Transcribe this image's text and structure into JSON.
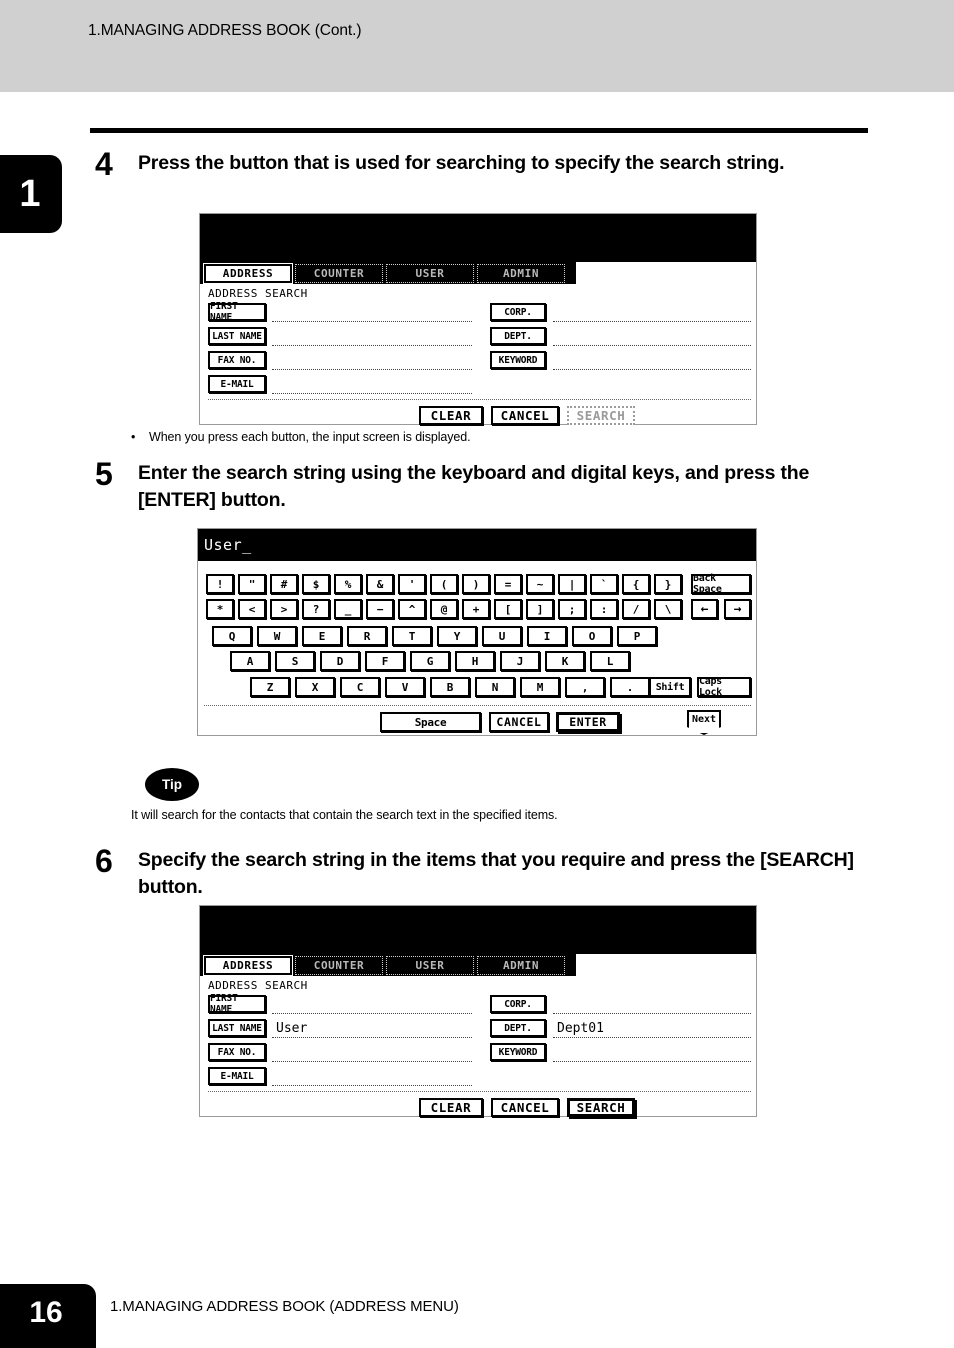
{
  "header": {
    "title": "1.MANAGING ADDRESS BOOK (Cont.)"
  },
  "side_tab": {
    "chapter": "1"
  },
  "footer": {
    "page": "16",
    "title": "1.MANAGING ADDRESS BOOK (ADDRESS MENU)"
  },
  "steps": [
    {
      "num": "4",
      "text": "Press the button that is used for searching to specify the search string."
    },
    {
      "num": "5",
      "text": "Enter the search string using the keyboard and digital keys, and press the [ENTER] button."
    },
    {
      "num": "6",
      "text": "Specify the search string in the items that you require and press the [SEARCH] button."
    }
  ],
  "note": {
    "bullet": "•",
    "text": "When you press each button, the input screen is displayed."
  },
  "tip": {
    "label": "Tip",
    "text": "It will search for the contacts that contain the search text in the specified items."
  },
  "screen_empty": {
    "tabs": [
      {
        "label": "ADDRESS",
        "selected": true
      },
      {
        "label": "COUNTER",
        "selected": false
      },
      {
        "label": "USER",
        "selected": false
      },
      {
        "label": "ADMIN",
        "selected": false
      }
    ],
    "title": "ADDRESS SEARCH",
    "left_fields": [
      {
        "label": "FIRST NAME",
        "value": ""
      },
      {
        "label": "LAST NAME",
        "value": ""
      },
      {
        "label": "FAX NO.",
        "value": ""
      },
      {
        "label": "E-MAIL",
        "value": ""
      }
    ],
    "right_fields": [
      {
        "label": "CORP.",
        "value": ""
      },
      {
        "label": "DEPT.",
        "value": ""
      },
      {
        "label": "KEYWORD",
        "value": ""
      }
    ],
    "actions": [
      {
        "label": "CLEAR",
        "state": "normal"
      },
      {
        "label": "CANCEL",
        "state": "normal"
      },
      {
        "label": "SEARCH",
        "state": "disabled"
      }
    ]
  },
  "screen_filled": {
    "tabs": [
      {
        "label": "ADDRESS",
        "selected": true
      },
      {
        "label": "COUNTER",
        "selected": false
      },
      {
        "label": "USER",
        "selected": false
      },
      {
        "label": "ADMIN",
        "selected": false
      }
    ],
    "title": "ADDRESS SEARCH",
    "left_fields": [
      {
        "label": "FIRST NAME",
        "value": ""
      },
      {
        "label": "LAST NAME",
        "value": "User"
      },
      {
        "label": "FAX NO.",
        "value": ""
      },
      {
        "label": "E-MAIL",
        "value": ""
      }
    ],
    "right_fields": [
      {
        "label": "CORP.",
        "value": ""
      },
      {
        "label": "DEPT.",
        "value": "Dept01"
      },
      {
        "label": "KEYWORD",
        "value": ""
      }
    ],
    "actions": [
      {
        "label": "CLEAR",
        "state": "normal"
      },
      {
        "label": "CANCEL",
        "state": "normal"
      },
      {
        "label": "SEARCH",
        "state": "active"
      }
    ]
  },
  "keyboard": {
    "input_value": "User_",
    "row1": [
      "!",
      "\"",
      "#",
      "$",
      "%",
      "&",
      "'",
      "(",
      ")",
      "=",
      "~",
      "|",
      "`",
      "{",
      "}"
    ],
    "row2": [
      "*",
      "<",
      ">",
      "?",
      "_",
      "−",
      "^",
      "@",
      "+",
      "[",
      "]",
      ";",
      ":",
      "/",
      "\\"
    ],
    "row3": [
      "Q",
      "W",
      "E",
      "R",
      "T",
      "Y",
      "U",
      "I",
      "O",
      "P"
    ],
    "row4": [
      "A",
      "S",
      "D",
      "F",
      "G",
      "H",
      "J",
      "K",
      "L"
    ],
    "row5": [
      "Z",
      "X",
      "C",
      "V",
      "B",
      "N",
      "M",
      ",",
      "."
    ],
    "back_space": "Back Space",
    "arrow_left": "←",
    "arrow_right": "→",
    "shift": "Shift",
    "caps_lock": "Caps Lock",
    "space": "Space",
    "cancel": "CANCEL",
    "enter": "ENTER",
    "next": "Next"
  }
}
